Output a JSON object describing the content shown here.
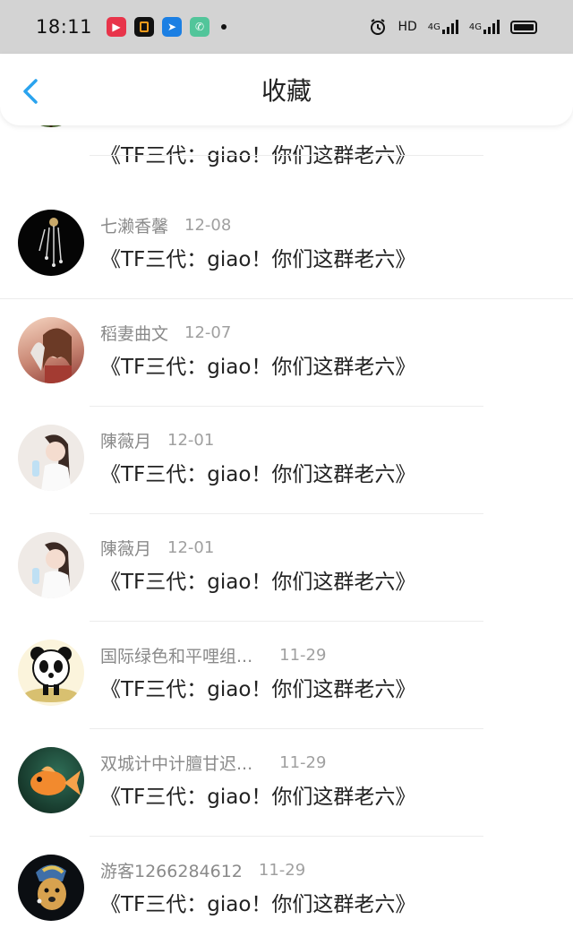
{
  "status_bar": {
    "time": "18:11",
    "indicators": [
      "HD",
      "4G",
      "4G"
    ]
  },
  "header": {
    "title": "收藏",
    "back_icon": "chevron-left-icon"
  },
  "items": [
    {
      "name": "",
      "date": "",
      "content": "《TF三代：giao！你们这群老六》",
      "avatar_icon": "plant-icon"
    },
    {
      "name": "七濑香馨",
      "date": "12-08",
      "content": "《TF三代：giao！你们这群老六》",
      "avatar_icon": "tassel-icon"
    },
    {
      "name": "稻妻曲文",
      "date": "12-07",
      "content": "《TF三代：giao！你们这群老六》",
      "avatar_icon": "anime-girl-icon"
    },
    {
      "name": "陳薇月",
      "date": "12-01",
      "content": "《TF三代：giao！你们这群老六》",
      "avatar_icon": "girl-photo-icon"
    },
    {
      "name": "陳薇月",
      "date": "12-01",
      "content": "《TF三代：giao！你们这群老六》",
      "avatar_icon": "girl-photo-icon"
    },
    {
      "name": "国际绿色和平哩组...",
      "date": "11-29",
      "content": "《TF三代：giao！你们这群老六》",
      "avatar_icon": "panda-icon"
    },
    {
      "name": "双城计中计膻甘迟...",
      "date": "11-29",
      "content": "《TF三代：giao！你们这群老六》",
      "avatar_icon": "goldfish-icon"
    },
    {
      "name": "游客1266284612",
      "date": "11-29",
      "content": "《TF三代：giao！你们这群老六》",
      "avatar_icon": "pearl-earring-dog-icon"
    }
  ],
  "colors": {
    "status_bar_bg": "#d3d3d3",
    "accent": "#2aa3ee",
    "name_gray": "#8a8a8a"
  }
}
